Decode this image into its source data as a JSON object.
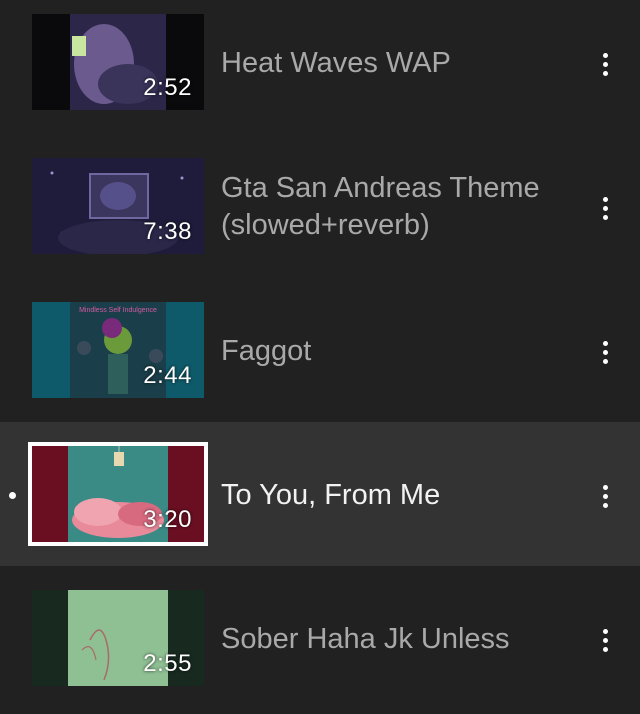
{
  "playlist": {
    "items": [
      {
        "title": "Heat Waves WAP",
        "duration": "2:52",
        "active": false,
        "thumb_icon": "thumbnail-image"
      },
      {
        "title": "Gta San Andreas Theme (slowed+reverb)",
        "duration": "7:38",
        "active": false,
        "thumb_icon": "thumbnail-image"
      },
      {
        "title": "Faggot",
        "duration": "2:44",
        "active": false,
        "thumb_icon": "thumbnail-image",
        "thumb_text": "Mindless Self Indulgence"
      },
      {
        "title": "To You, From Me",
        "duration": "3:20",
        "active": true,
        "thumb_icon": "thumbnail-image"
      },
      {
        "title": "Sober Haha Jk Unless",
        "duration": "2:55",
        "active": false,
        "thumb_icon": "thumbnail-image"
      }
    ],
    "more_icon": "more-vert-icon",
    "colors": {
      "background": "#212121",
      "active_row": "#333333",
      "title_inactive": "#a9a9a9",
      "title_active": "#f2f2f2"
    }
  }
}
